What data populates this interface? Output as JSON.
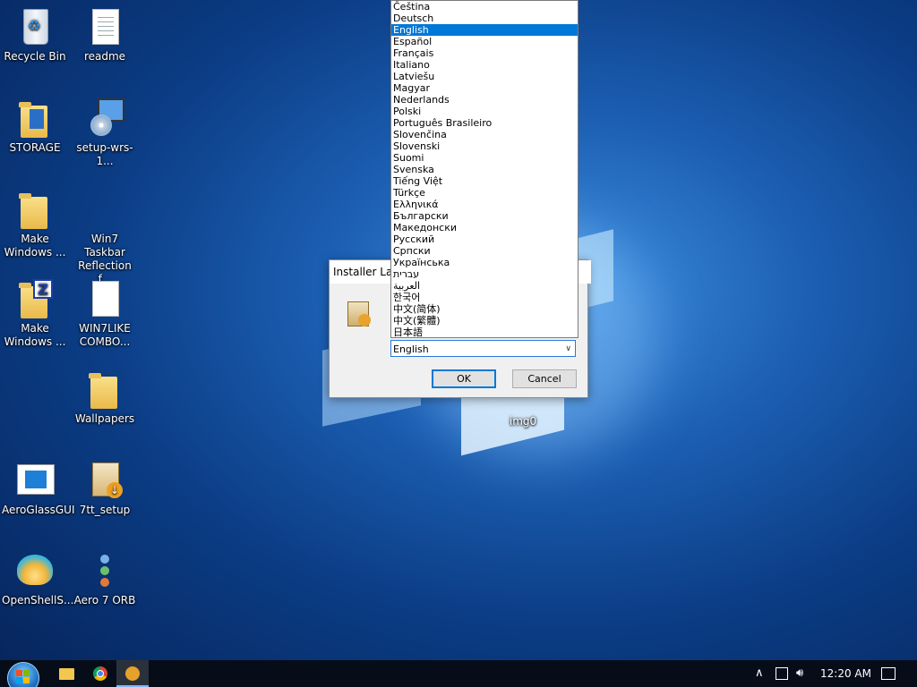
{
  "desktop": {
    "icons": [
      {
        "label": "Recycle Bin"
      },
      {
        "label": "readme"
      },
      {
        "label": "STORAGE"
      },
      {
        "label": "setup-wrs-1..."
      },
      {
        "label": "Make Windows ..."
      },
      {
        "label": "Win7 Taskbar Reflection f..."
      },
      {
        "label": "Make Windows ..."
      },
      {
        "label": "WIN7LIKE COMBO..."
      },
      {
        "label": "Wallpapers"
      },
      {
        "label": "AeroGlassGUI"
      },
      {
        "label": "7tt_setup"
      },
      {
        "label": "OpenShellS..."
      },
      {
        "label": "Aero 7 ORB"
      },
      {
        "label": "img0"
      }
    ]
  },
  "dialog": {
    "title": "Installer Language",
    "selected_value": "English",
    "ok_label": "OK",
    "cancel_label": "Cancel"
  },
  "dropdown": {
    "selected": "English",
    "options": [
      "Čeština",
      "Deutsch",
      "English",
      "Español",
      "Français",
      "Italiano",
      "Latviešu",
      "Magyar",
      "Nederlands",
      "Polski",
      "Português Brasileiro",
      "Slovenčina",
      "Slovenski",
      "Suomi",
      "Svenska",
      "Tiếng Việt",
      "Türkçe",
      "Ελληνικά",
      "Български",
      "Македонски",
      "Русский",
      "Српски",
      "Українська",
      "עברית",
      "العربية",
      "한국어",
      "中文(简体)",
      "中文(繁體)",
      "日本語"
    ]
  },
  "taskbar": {
    "pinned": [
      "file-explorer-icon",
      "chrome-icon",
      "installer-icon"
    ],
    "clock": "12:20 AM"
  },
  "colors": {
    "accent": "#0078d7",
    "taskbar": "#070d18"
  }
}
